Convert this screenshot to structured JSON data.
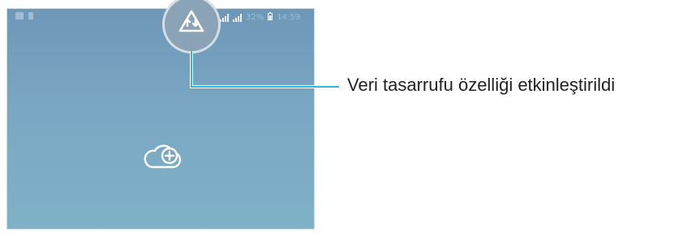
{
  "status_bar": {
    "signal_strength": "full",
    "battery_percent": "32%",
    "time": "14:59"
  },
  "data_saver": {
    "icon": "data-saver-icon",
    "callout_label": "Veri tasarrufu özelliği etkinleştirildi"
  },
  "home_screen": {
    "center_icon": "cloud-add-icon"
  },
  "colors": {
    "screen_top": "#6e97b8",
    "screen_bottom": "#7fb1c7",
    "callout_line": "#2fb7d6",
    "text": "#222222"
  }
}
